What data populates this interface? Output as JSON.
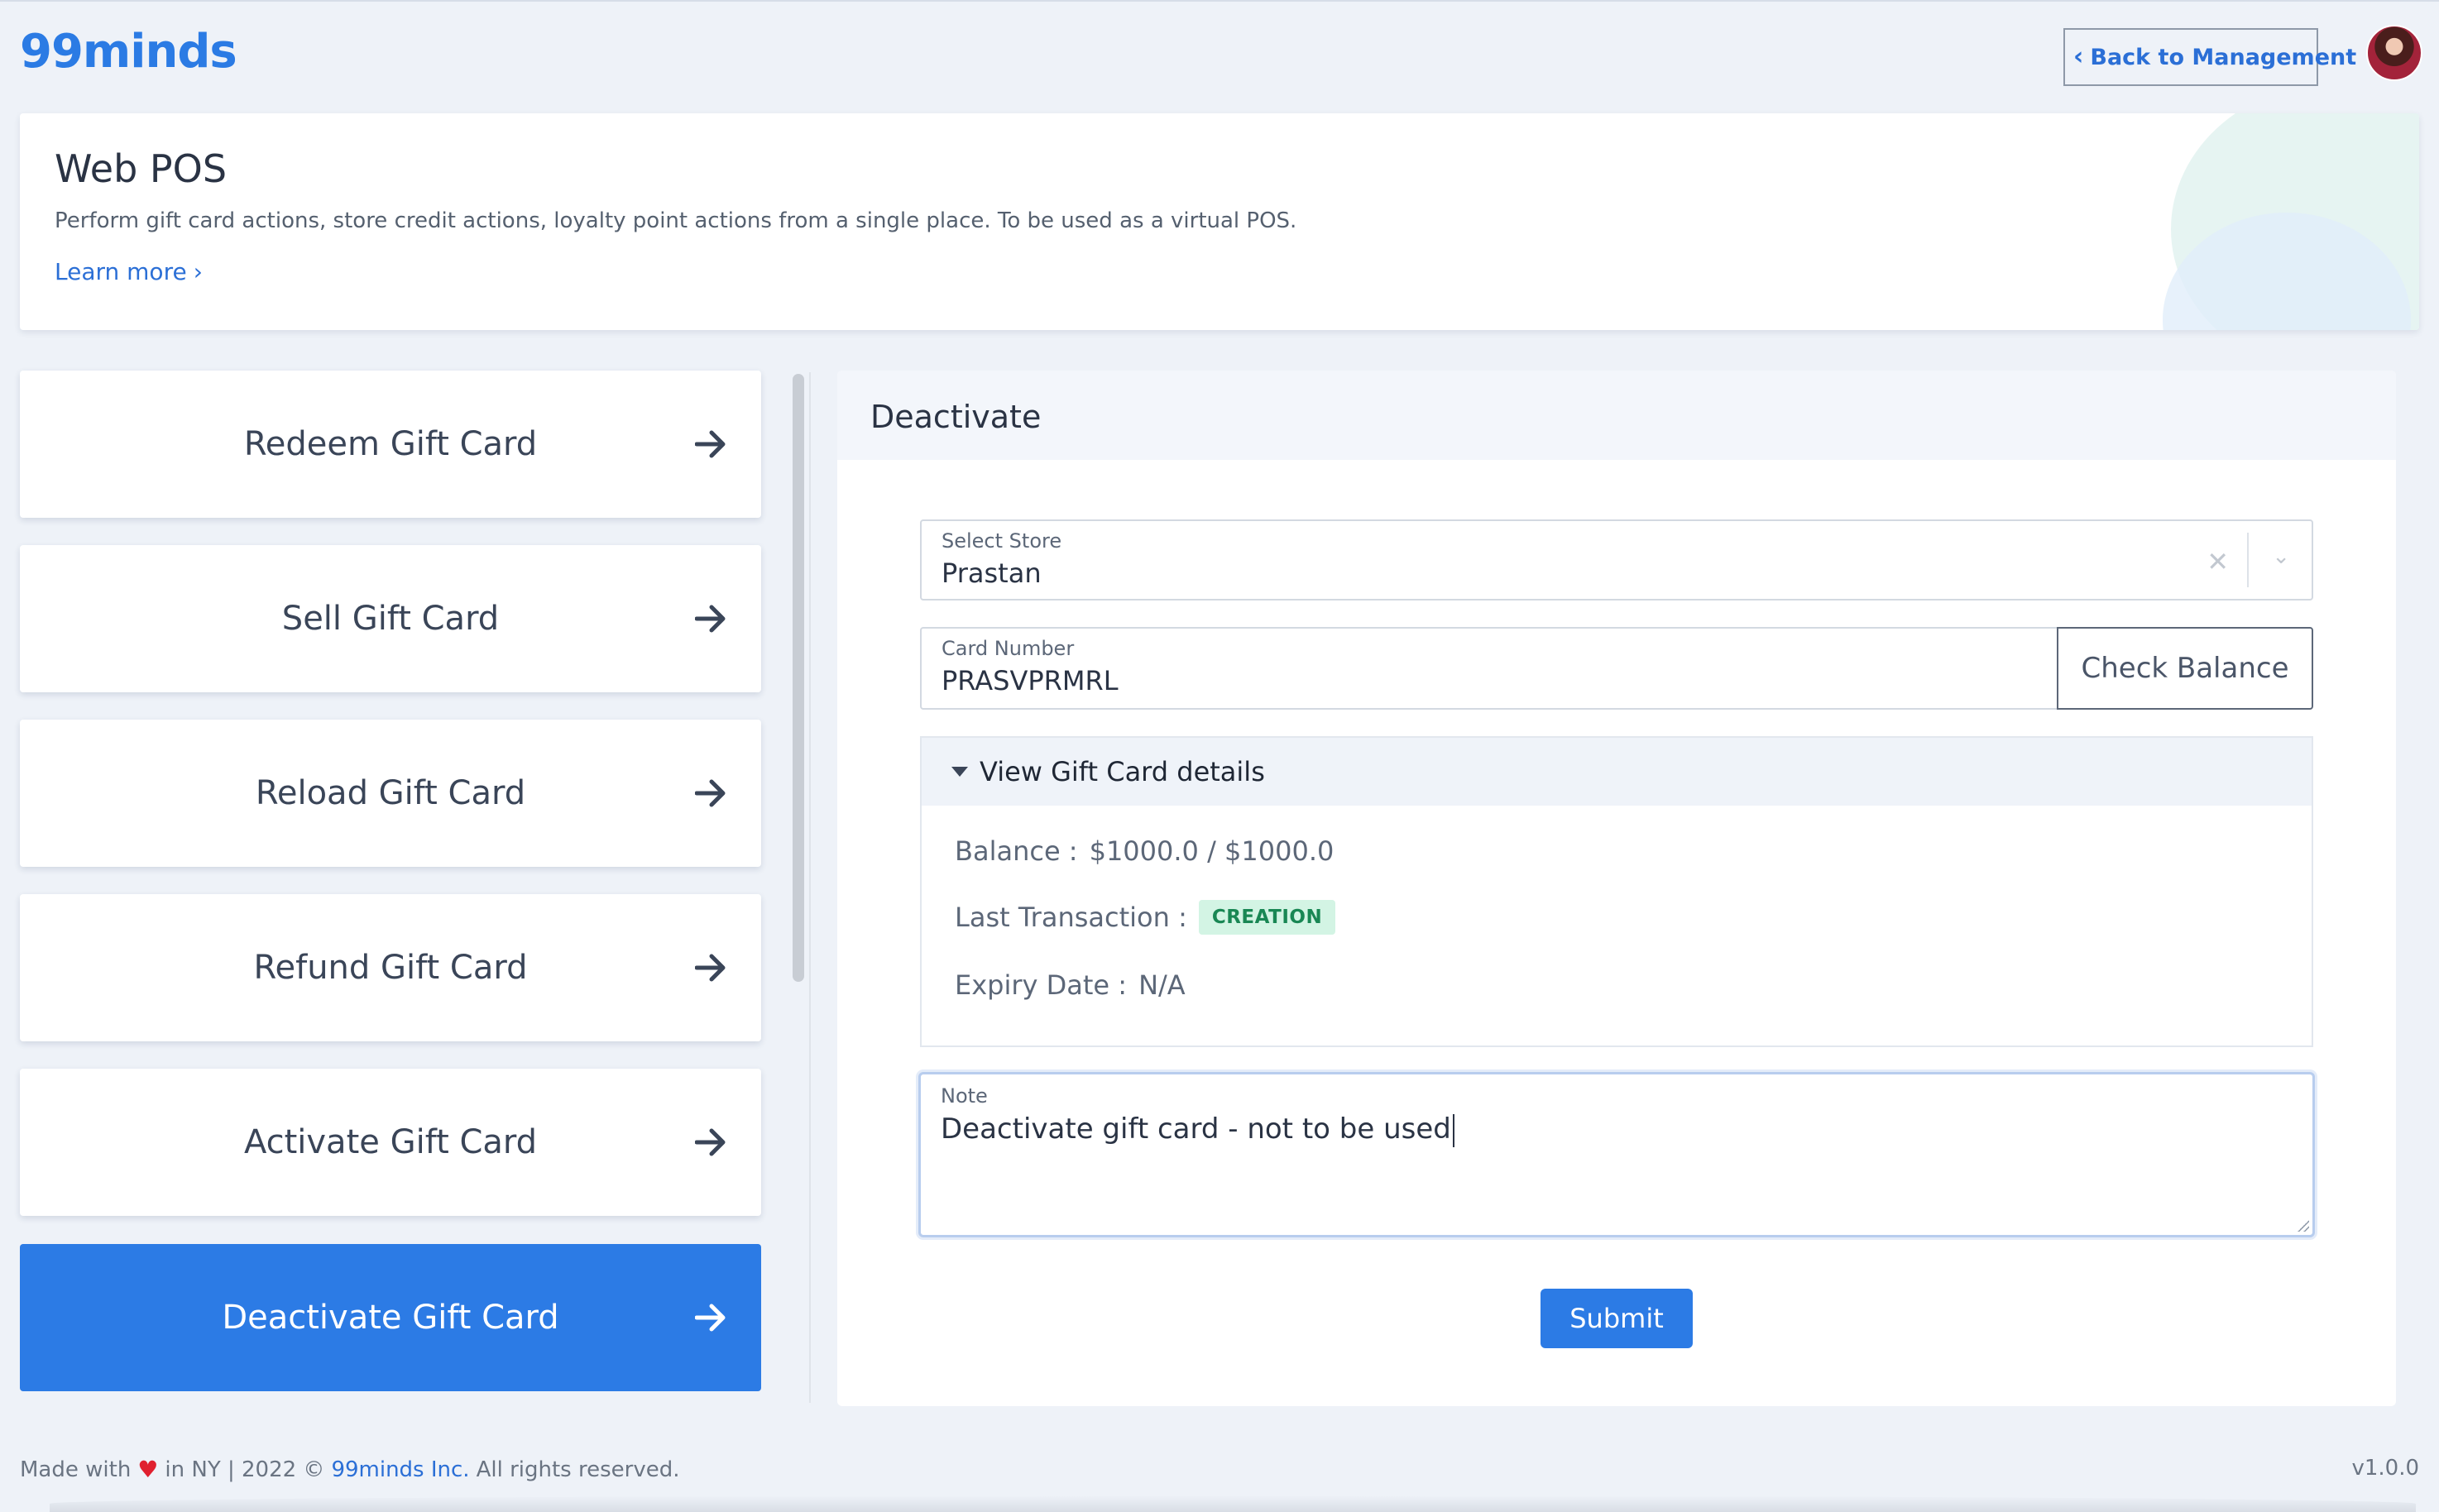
{
  "header": {
    "logo": "99minds",
    "back_label": "Back to Management"
  },
  "banner": {
    "title": "Web POS",
    "description": "Perform gift card actions, store credit actions, loyalty point actions from a single place. To be used as a virtual POS.",
    "learn_more": "Learn more"
  },
  "actions": [
    {
      "label": "Redeem Gift Card",
      "active": false
    },
    {
      "label": "Sell Gift Card",
      "active": false
    },
    {
      "label": "Reload Gift Card",
      "active": false
    },
    {
      "label": "Refund Gift Card",
      "active": false
    },
    {
      "label": "Activate Gift Card",
      "active": false
    },
    {
      "label": "Deactivate Gift Card",
      "active": true
    }
  ],
  "panel": {
    "title": "Deactivate",
    "store": {
      "label": "Select Store",
      "value": "Prastan"
    },
    "card_number": {
      "label": "Card Number",
      "value": "PRASVPRMRL"
    },
    "check_balance_label": "Check Balance",
    "details": {
      "title": "View Gift Card details",
      "balance_label": "Balance :",
      "balance_value": "$1000.0 / $1000.0",
      "last_txn_label": "Last Transaction :",
      "last_txn_badge": "CREATION",
      "expiry_label": "Expiry Date :",
      "expiry_value": "N/A"
    },
    "note": {
      "label": "Note",
      "value": "Deactivate gift card - not to be used"
    },
    "submit_label": "Submit"
  },
  "footer": {
    "made_with": "Made with",
    "location": "in NY | 2022 ©",
    "company": "99minds Inc.",
    "rights": "All rights reserved.",
    "version": "v1.0.0"
  },
  "colors": {
    "accent": "#2c7be5",
    "background": "#eef2f8",
    "badge_bg": "#d3f4e4",
    "badge_text": "#198754"
  }
}
